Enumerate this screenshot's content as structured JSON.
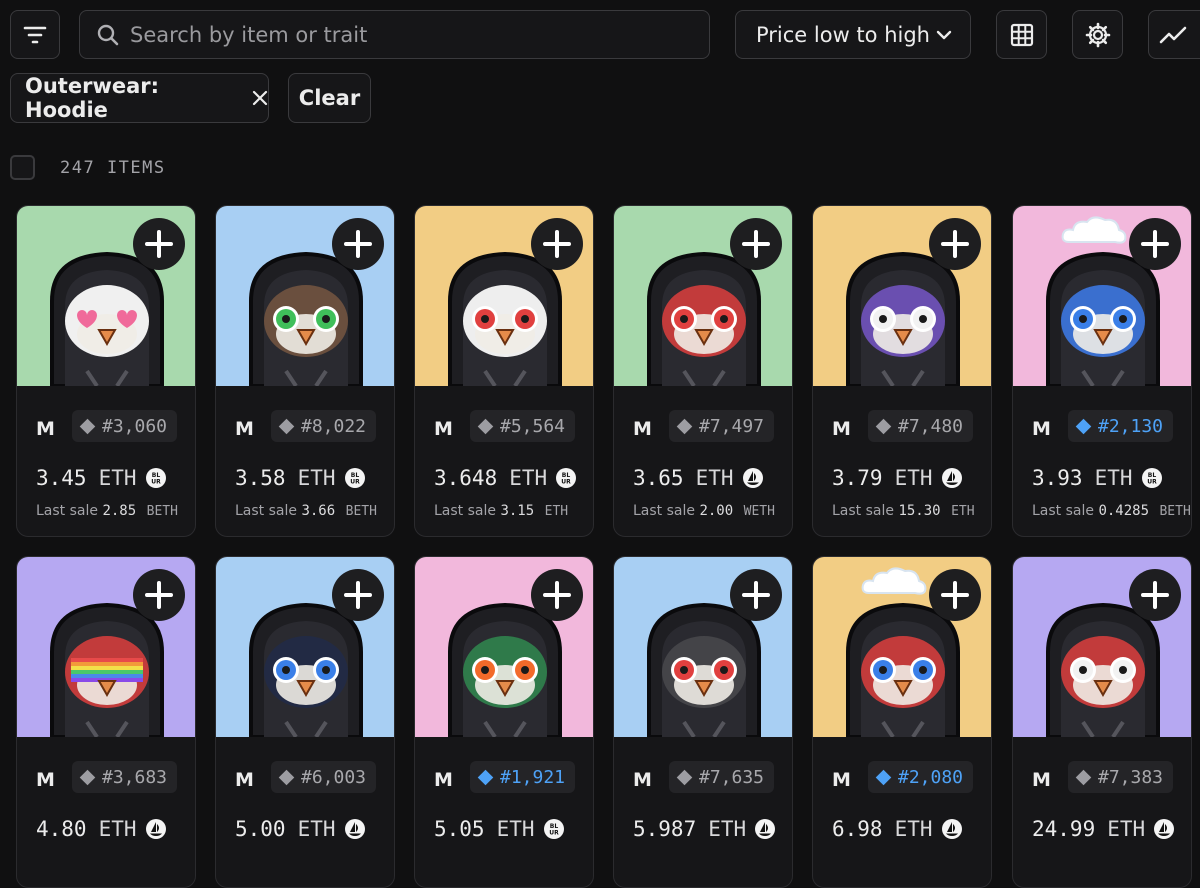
{
  "toolbar": {
    "filter_icon": "filter-icon",
    "search_placeholder": "Search by item or trait",
    "sort_label": "Price low to high",
    "grid_icon": "grid-icon",
    "settings_icon": "gear-icon",
    "chart_icon": "chart-icon"
  },
  "filters": {
    "active_chip": "Outerwear: Hoodie",
    "clear_label": "Clear"
  },
  "results": {
    "count_label": "247 ITEMS"
  },
  "items": [
    {
      "mark": "M",
      "token": "#3,060",
      "rare": false,
      "price": "3.45",
      "currency": "ETH",
      "market": "blur",
      "last_label": "Last sale",
      "last_value": "2.85",
      "last_currency": "BETH",
      "bg": "#a8d9ad",
      "eyes": "hearts",
      "face": "#f0f0f0",
      "beak": "#e58b4a",
      "cloud": false
    },
    {
      "mark": "M",
      "token": "#8,022",
      "rare": false,
      "price": "3.58",
      "currency": "ETH",
      "market": "blur",
      "last_label": "Last sale",
      "last_value": "3.66",
      "last_currency": "BETH",
      "bg": "#a8cff3",
      "eyes": "green",
      "face": "#6a4f3e",
      "beak": "#e58b4a",
      "cloud": false
    },
    {
      "mark": "M",
      "token": "#5,564",
      "rare": false,
      "price": "3.648",
      "currency": "ETH",
      "market": "blur",
      "last_label": "Last sale",
      "last_value": "3.15",
      "last_currency": "ETH",
      "bg": "#f2cd84",
      "eyes": "red",
      "face": "#eeeeee",
      "beak": "#e58b4a",
      "cloud": false
    },
    {
      "mark": "M",
      "token": "#7,497",
      "rare": false,
      "price": "3.65",
      "currency": "ETH",
      "market": "opensea",
      "last_label": "Last sale",
      "last_value": "2.00",
      "last_currency": "WETH",
      "bg": "#a8d9ad",
      "eyes": "red",
      "face": "#c23b3b",
      "beak": "#e58b4a",
      "cloud": false
    },
    {
      "mark": "M",
      "token": "#7,480",
      "rare": false,
      "price": "3.79",
      "currency": "ETH",
      "market": "opensea",
      "last_label": "Last sale",
      "last_value": "15.30",
      "last_currency": "ETH",
      "bg": "#f2cd84",
      "eyes": "white",
      "face": "#6a4fb0",
      "beak": "#e58b4a",
      "cloud": false
    },
    {
      "mark": "M",
      "token": "#2,130",
      "rare": true,
      "price": "3.93",
      "currency": "ETH",
      "market": "blur",
      "last_label": "Last sale",
      "last_value": "0.4285",
      "last_currency": "BETH",
      "bg": "#f2b8dc",
      "eyes": "blue",
      "face": "#3a6fcf",
      "beak": "#e58b4a",
      "cloud": true
    },
    {
      "mark": "M",
      "token": "#3,683",
      "rare": false,
      "price": "4.80",
      "currency": "ETH",
      "market": "opensea",
      "last_label": "",
      "last_value": "",
      "last_currency": "",
      "bg": "#b6a8f2",
      "eyes": "rainbow",
      "face": "#c23b3b",
      "beak": "#e58b4a",
      "cloud": false
    },
    {
      "mark": "M",
      "token": "#6,003",
      "rare": false,
      "price": "5.00",
      "currency": "ETH",
      "market": "opensea",
      "last_label": "",
      "last_value": "",
      "last_currency": "",
      "bg": "#a8cff3",
      "eyes": "blue",
      "face": "#222a44",
      "beak": "#e58b4a",
      "cloud": false
    },
    {
      "mark": "M",
      "token": "#1,921",
      "rare": true,
      "price": "5.05",
      "currency": "ETH",
      "market": "blur",
      "last_label": "",
      "last_value": "",
      "last_currency": "",
      "bg": "#f2b8dc",
      "eyes": "fire",
      "face": "#2f7a4a",
      "beak": "#e58b4a",
      "cloud": false
    },
    {
      "mark": "M",
      "token": "#7,635",
      "rare": false,
      "price": "5.987",
      "currency": "ETH",
      "market": "opensea",
      "last_label": "",
      "last_value": "",
      "last_currency": "",
      "bg": "#a8cff3",
      "eyes": "red",
      "face": "#444448",
      "beak": "#e58b4a",
      "cloud": false
    },
    {
      "mark": "M",
      "token": "#2,080",
      "rare": true,
      "price": "6.98",
      "currency": "ETH",
      "market": "opensea",
      "last_label": "",
      "last_value": "",
      "last_currency": "",
      "bg": "#f2cd84",
      "eyes": "blue",
      "face": "#c23b3b",
      "beak": "#e58b4a",
      "cloud": true
    },
    {
      "mark": "M",
      "token": "#7,383",
      "rare": false,
      "price": "24.99",
      "currency": "ETH",
      "market": "opensea",
      "last_label": "",
      "last_value": "",
      "last_currency": "",
      "bg": "#b6a8f2",
      "eyes": "white",
      "face": "#c23b3b",
      "beak": "#e58b4a",
      "cloud": false
    }
  ],
  "icons": {
    "plus": "plus-icon",
    "blur_badge": "blur-marketplace-icon",
    "opensea_badge": "opensea-icon",
    "rarity": "diamond-icon"
  }
}
